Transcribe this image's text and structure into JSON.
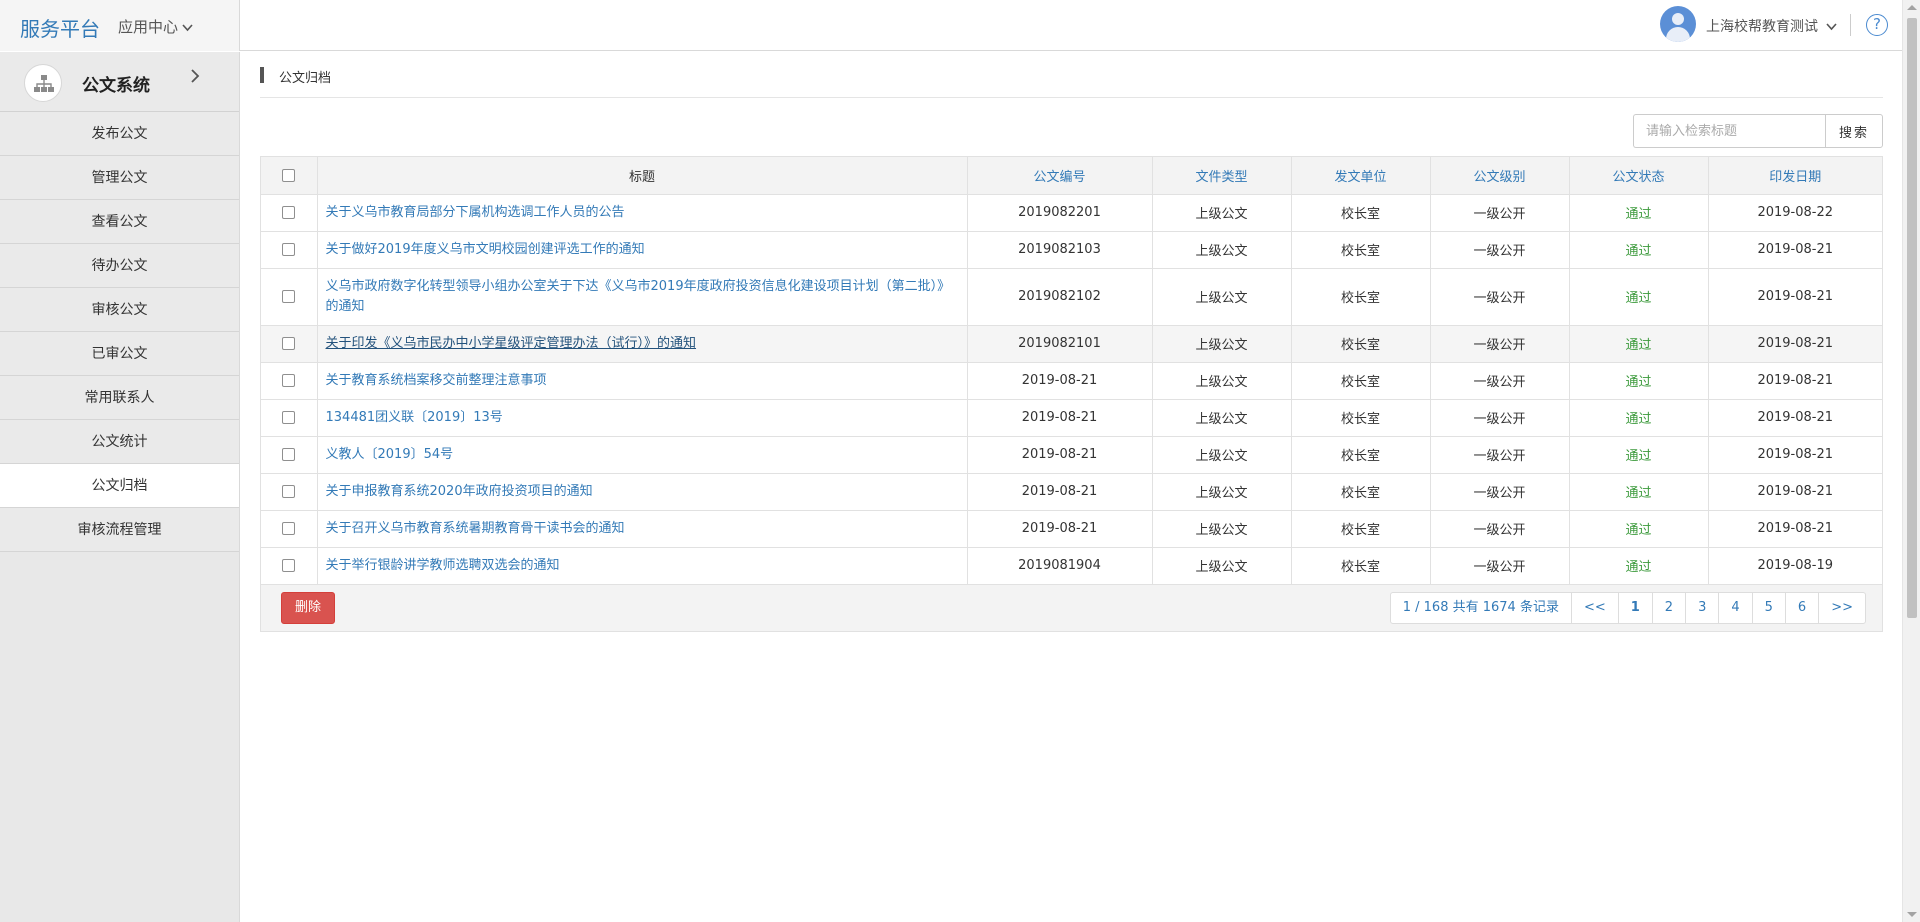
{
  "header": {
    "brand": "服务平台",
    "app_center": "应用中心",
    "user_name": "上海校帮教育测试",
    "help_glyph": "?"
  },
  "sidebar": {
    "system_title": "公文系统",
    "items": [
      {
        "label": "发布公文"
      },
      {
        "label": "管理公文"
      },
      {
        "label": "查看公文"
      },
      {
        "label": "待办公文"
      },
      {
        "label": "审核公文"
      },
      {
        "label": "已审公文"
      },
      {
        "label": "常用联系人"
      },
      {
        "label": "公文统计"
      },
      {
        "label": "公文归档"
      },
      {
        "label": "审核流程管理"
      }
    ]
  },
  "breadcrumb": "公文归档",
  "search": {
    "placeholder": "请输入检索标题",
    "button": "搜索"
  },
  "table": {
    "headers": {
      "title": "标题",
      "doc_no": "公文编号",
      "file_type": "文件类型",
      "issuer": "发文单位",
      "level": "公文级别",
      "status": "公文状态",
      "date": "印发日期"
    },
    "rows": [
      {
        "title": "关于义乌市教育局部分下属机构选调工作人员的公告",
        "doc_no": "2019082201",
        "file_type": "上级公文",
        "issuer": "校长室",
        "level": "一级公开",
        "status": "通过",
        "date": "2019-08-22"
      },
      {
        "title": "关于做好2019年度义乌市文明校园创建评选工作的通知",
        "doc_no": "2019082103",
        "file_type": "上级公文",
        "issuer": "校长室",
        "level": "一级公开",
        "status": "通过",
        "date": "2019-08-21"
      },
      {
        "title": "义乌市政府数字化转型领导小组办公室关于下达《义乌市2019年度政府投资信息化建设项目计划（第二批）》的通知",
        "doc_no": "2019082102",
        "file_type": "上级公文",
        "issuer": "校长室",
        "level": "一级公开",
        "status": "通过",
        "date": "2019-08-21"
      },
      {
        "title": "关于印发《义乌市民办中小学星级评定管理办法（试行）》的通知",
        "doc_no": "2019082101",
        "file_type": "上级公文",
        "issuer": "校长室",
        "level": "一级公开",
        "status": "通过",
        "date": "2019-08-21"
      },
      {
        "title": "关于教育系统档案移交前整理注意事项",
        "doc_no": "2019-08-21",
        "file_type": "上级公文",
        "issuer": "校长室",
        "level": "一级公开",
        "status": "通过",
        "date": "2019-08-21"
      },
      {
        "title": "134481团义联〔2019〕13号",
        "doc_no": "2019-08-21",
        "file_type": "上级公文",
        "issuer": "校长室",
        "level": "一级公开",
        "status": "通过",
        "date": "2019-08-21"
      },
      {
        "title": "义教人〔2019〕54号",
        "doc_no": "2019-08-21",
        "file_type": "上级公文",
        "issuer": "校长室",
        "level": "一级公开",
        "status": "通过",
        "date": "2019-08-21"
      },
      {
        "title": "关于申报教育系统2020年政府投资项目的通知",
        "doc_no": "2019-08-21",
        "file_type": "上级公文",
        "issuer": "校长室",
        "level": "一级公开",
        "status": "通过",
        "date": "2019-08-21"
      },
      {
        "title": "关于召开义乌市教育系统暑期教育骨干读书会的通知",
        "doc_no": "2019-08-21",
        "file_type": "上级公文",
        "issuer": "校长室",
        "level": "一级公开",
        "status": "通过",
        "date": "2019-08-21"
      },
      {
        "title": "关于举行银龄讲学教师选聘双选会的通知",
        "doc_no": "2019081904",
        "file_type": "上级公文",
        "issuer": "校长室",
        "level": "一级公开",
        "status": "通过",
        "date": "2019-08-19"
      }
    ]
  },
  "footer": {
    "delete_button": "删除",
    "page_info": "1 / 168 共有 1674 条记录",
    "first": "<<",
    "pages": [
      "1",
      "2",
      "3",
      "4",
      "5",
      "6"
    ],
    "last": ">>"
  },
  "colors": {
    "accent": "#337ab7",
    "status_ok": "#3c9a3c",
    "danger": "#d9534f"
  }
}
